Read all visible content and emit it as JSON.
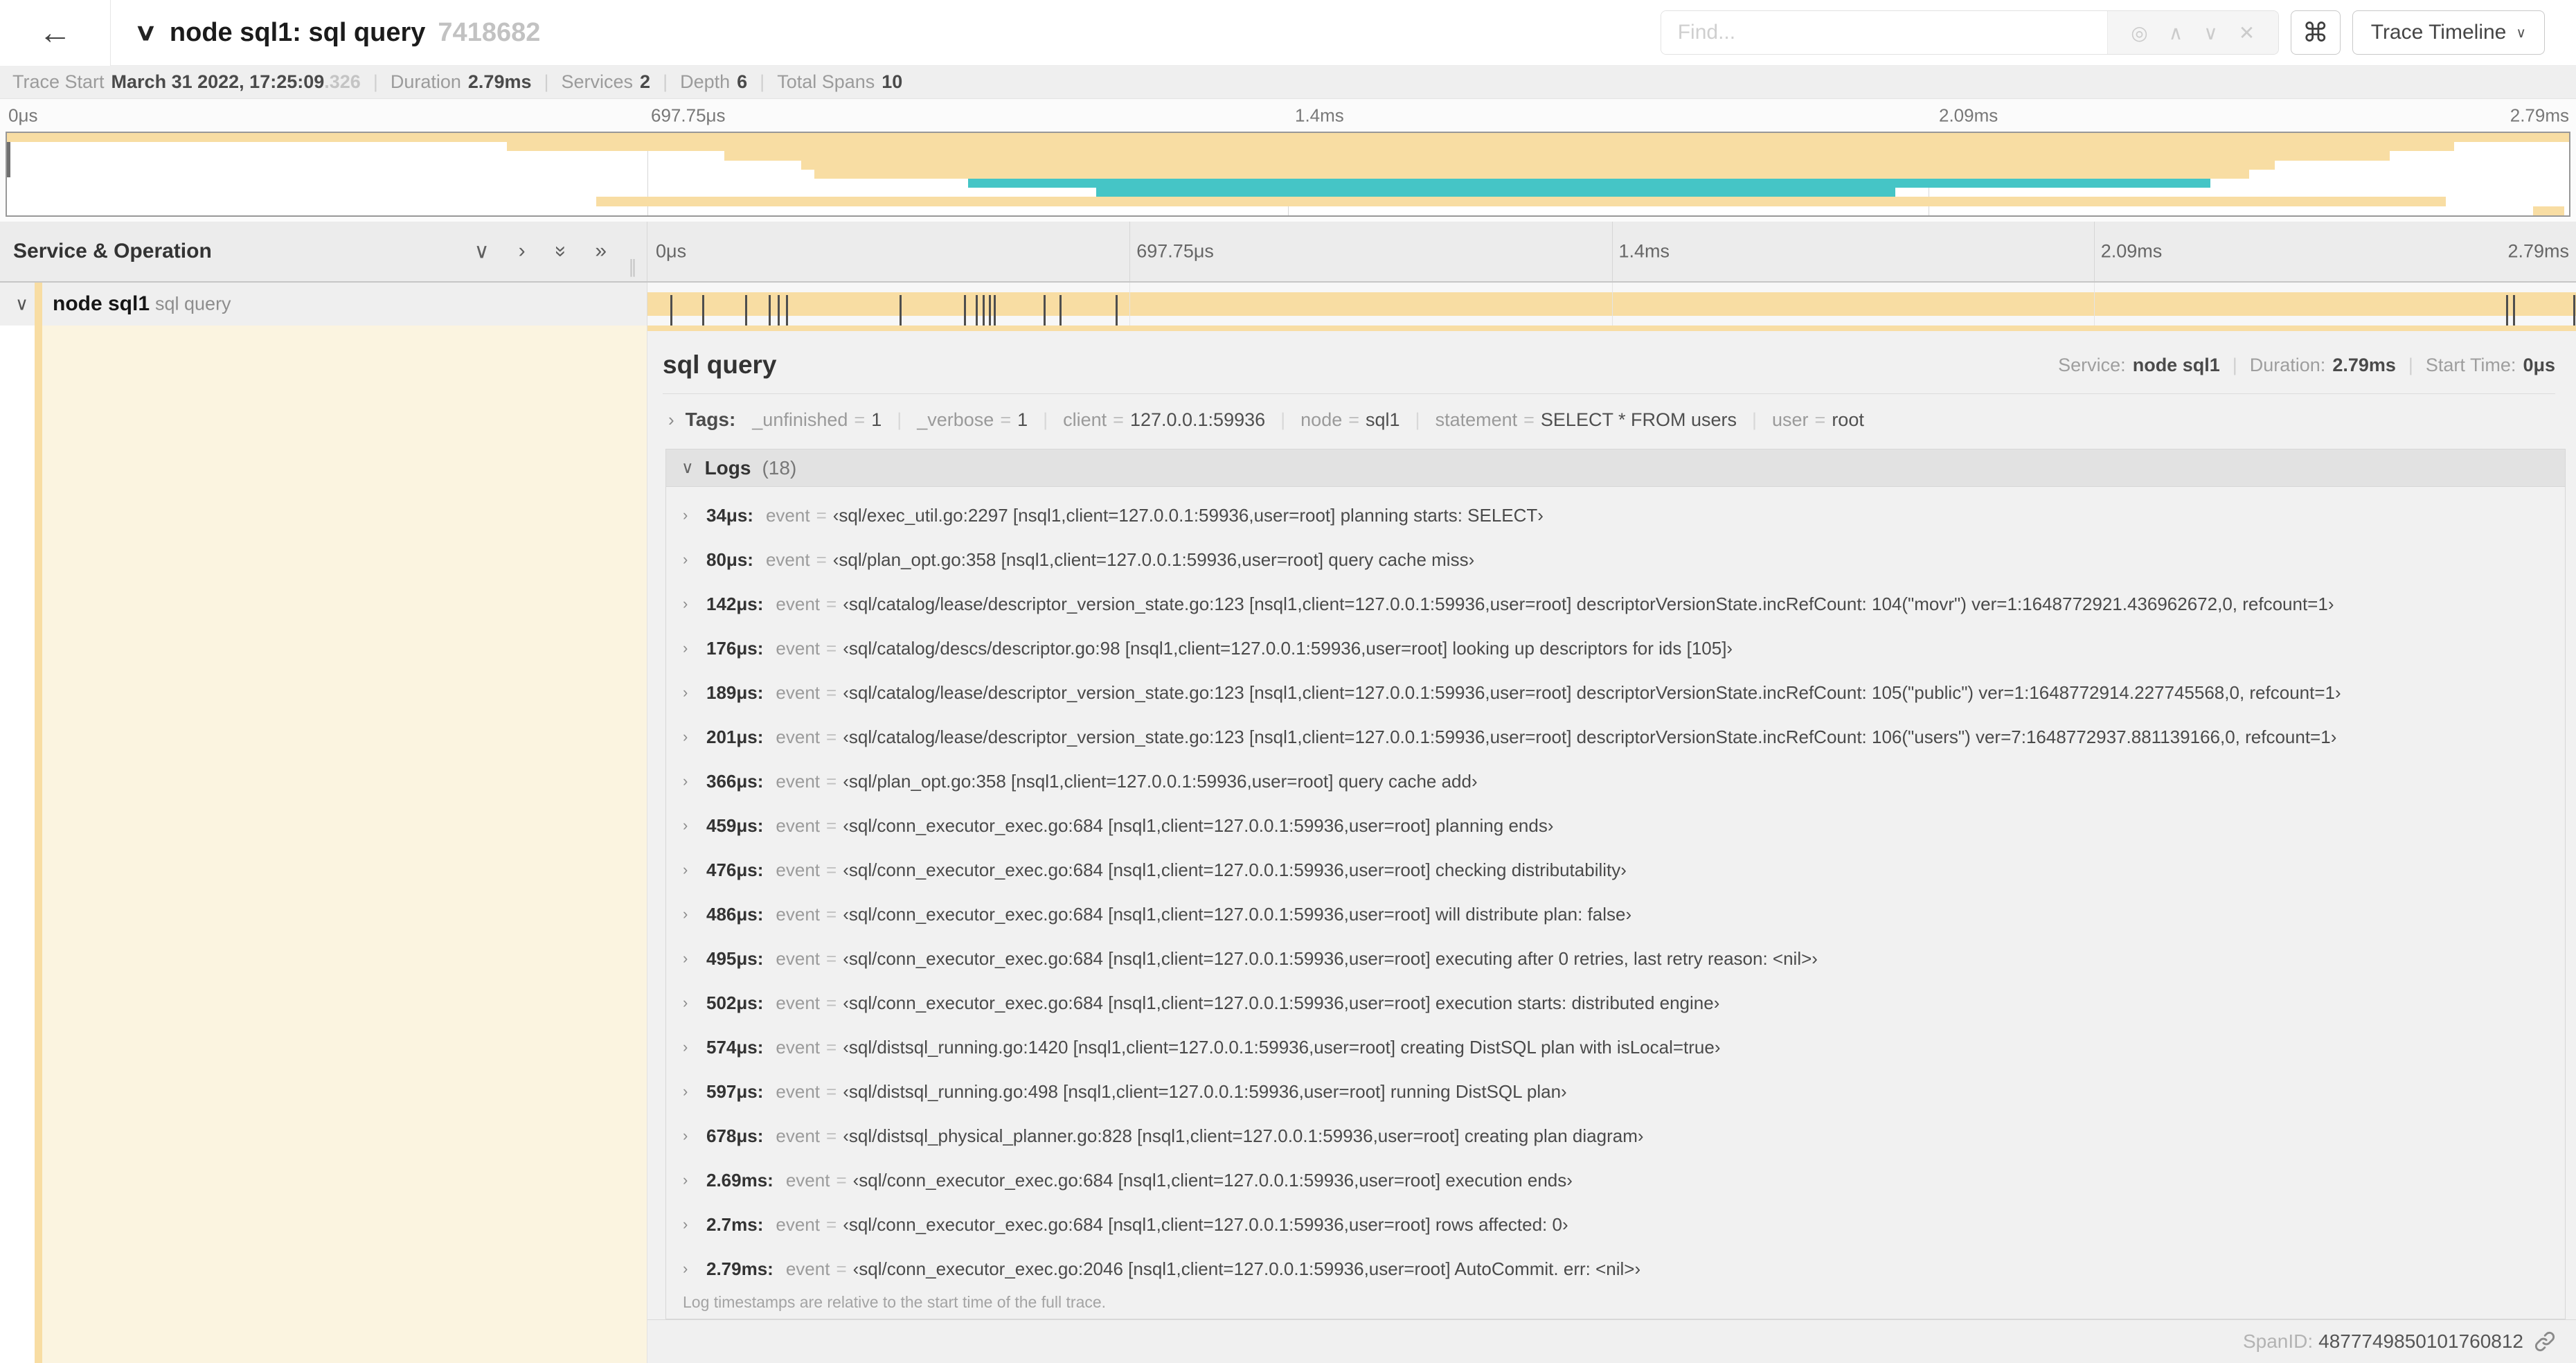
{
  "colors": {
    "tan": "#f8dda3",
    "teal": "#45c5c6"
  },
  "glyphs": {
    "separator": "|",
    "equals": "="
  },
  "icons": {
    "back": "←",
    "collapse": "∨",
    "locate": "◎",
    "prev": "∧",
    "next": "∨",
    "clear": "✕",
    "command": "⌘",
    "caret_down": "∨",
    "collapse_one": "∨",
    "expand_one": "›",
    "collapse_all": "»",
    "expand_all": "»",
    "grip": "∥",
    "row_chevron": "∨",
    "chevron_right": "›",
    "logs_open": "∨"
  },
  "header": {
    "title": "node sql1: sql query",
    "trace_id_short": "7418682",
    "find_placeholder": "Find...",
    "view_selector": "Trace Timeline"
  },
  "summary": {
    "items": [
      {
        "label": "Trace Start",
        "value": "March 31 2022, 17:25:09",
        "suffix": ".326"
      },
      {
        "label": "Duration",
        "value": "2.79ms"
      },
      {
        "label": "Services",
        "value": "2"
      },
      {
        "label": "Depth",
        "value": "6"
      },
      {
        "label": "Total Spans",
        "value": "10"
      }
    ]
  },
  "ruler": {
    "labels": [
      {
        "text": "0μs",
        "pct": 0
      },
      {
        "text": "697.75μs",
        "pct": 25
      },
      {
        "text": "1.4ms",
        "pct": 50
      },
      {
        "text": "2.09ms",
        "pct": 75
      },
      {
        "text": "2.79ms",
        "pct": 100
      }
    ]
  },
  "minimap": {
    "spans": [
      {
        "start": 0,
        "end": 100,
        "color": "tan"
      },
      {
        "start": 19.5,
        "end": 95.5,
        "color": "tan"
      },
      {
        "start": 28,
        "end": 93,
        "color": "tan"
      },
      {
        "start": 31,
        "end": 88.5,
        "color": "tan"
      },
      {
        "start": 31.5,
        "end": 87.5,
        "color": "tan"
      },
      {
        "start": 37.5,
        "end": 86,
        "color": "teal"
      },
      {
        "start": 42.5,
        "end": 73.7,
        "color": "teal"
      },
      {
        "start": 23,
        "end": 95.2,
        "color": "tan"
      },
      {
        "start": 98.6,
        "end": 99.8,
        "color": "tan"
      }
    ]
  },
  "timeline": {
    "left_header": "Service & Operation",
    "row": {
      "service": "node sql1",
      "operation": "sql query",
      "bar_color": "tan"
    },
    "ticks_pct": [
      1.22,
      2.87,
      5.09,
      6.31,
      6.77,
      7.2,
      13.12,
      16.45,
      17.06,
      17.42,
      17.74,
      17.99,
      20.57,
      21.4,
      24.3,
      96.42,
      96.77,
      99.9
    ]
  },
  "detail": {
    "title": "sql query",
    "meta": [
      {
        "label": "Service:",
        "value": "node sql1"
      },
      {
        "label": "Duration:",
        "value": "2.79ms"
      },
      {
        "label": "Start Time:",
        "value": "0μs"
      }
    ],
    "tags_label": "Tags:",
    "tags": [
      {
        "key": "_unfinished",
        "value": "1"
      },
      {
        "key": "_verbose",
        "value": "1"
      },
      {
        "key": "client",
        "value": "127.0.0.1:59936"
      },
      {
        "key": "node",
        "value": "sql1"
      },
      {
        "key": "statement",
        "value": "SELECT * FROM users"
      },
      {
        "key": "user",
        "value": "root"
      }
    ],
    "logs_label": "Logs",
    "logs_count": "(18)",
    "logs": [
      {
        "time": "34μs:",
        "field": "event",
        "text": "‹sql/exec_util.go:2297 [nsql1,client=127.0.0.1:59936,user=root] planning starts: SELECT›"
      },
      {
        "time": "80μs:",
        "field": "event",
        "text": "‹sql/plan_opt.go:358 [nsql1,client=127.0.0.1:59936,user=root] query cache miss›"
      },
      {
        "time": "142μs:",
        "field": "event",
        "text": "‹sql/catalog/lease/descriptor_version_state.go:123 [nsql1,client=127.0.0.1:59936,user=root] descriptorVersionState.incRefCount: 104(\"movr\") ver=1:1648772921.436962672,0, refcount=1›"
      },
      {
        "time": "176μs:",
        "field": "event",
        "text": "‹sql/catalog/descs/descriptor.go:98 [nsql1,client=127.0.0.1:59936,user=root] looking up descriptors for ids [105]›"
      },
      {
        "time": "189μs:",
        "field": "event",
        "text": "‹sql/catalog/lease/descriptor_version_state.go:123 [nsql1,client=127.0.0.1:59936,user=root] descriptorVersionState.incRefCount: 105(\"public\") ver=1:1648772914.227745568,0, refcount=1›"
      },
      {
        "time": "201μs:",
        "field": "event",
        "text": "‹sql/catalog/lease/descriptor_version_state.go:123 [nsql1,client=127.0.0.1:59936,user=root] descriptorVersionState.incRefCount: 106(\"users\") ver=7:1648772937.881139166,0, refcount=1›"
      },
      {
        "time": "366μs:",
        "field": "event",
        "text": "‹sql/plan_opt.go:358 [nsql1,client=127.0.0.1:59936,user=root] query cache add›"
      },
      {
        "time": "459μs:",
        "field": "event",
        "text": "‹sql/conn_executor_exec.go:684 [nsql1,client=127.0.0.1:59936,user=root] planning ends›"
      },
      {
        "time": "476μs:",
        "field": "event",
        "text": "‹sql/conn_executor_exec.go:684 [nsql1,client=127.0.0.1:59936,user=root] checking distributability›"
      },
      {
        "time": "486μs:",
        "field": "event",
        "text": "‹sql/conn_executor_exec.go:684 [nsql1,client=127.0.0.1:59936,user=root] will distribute plan: false›"
      },
      {
        "time": "495μs:",
        "field": "event",
        "text": "‹sql/conn_executor_exec.go:684 [nsql1,client=127.0.0.1:59936,user=root] executing after 0 retries, last retry reason: <nil>›"
      },
      {
        "time": "502μs:",
        "field": "event",
        "text": "‹sql/conn_executor_exec.go:684 [nsql1,client=127.0.0.1:59936,user=root] execution starts: distributed engine›"
      },
      {
        "time": "574μs:",
        "field": "event",
        "text": "‹sql/distsql_running.go:1420 [nsql1,client=127.0.0.1:59936,user=root] creating DistSQL plan with isLocal=true›"
      },
      {
        "time": "597μs:",
        "field": "event",
        "text": "‹sql/distsql_running.go:498 [nsql1,client=127.0.0.1:59936,user=root] running DistSQL plan›"
      },
      {
        "time": "678μs:",
        "field": "event",
        "text": "‹sql/distsql_physical_planner.go:828 [nsql1,client=127.0.0.1:59936,user=root] creating plan diagram›"
      },
      {
        "time": "2.69ms:",
        "field": "event",
        "text": "‹sql/conn_executor_exec.go:684 [nsql1,client=127.0.0.1:59936,user=root] execution ends›"
      },
      {
        "time": "2.7ms:",
        "field": "event",
        "text": "‹sql/conn_executor_exec.go:684 [nsql1,client=127.0.0.1:59936,user=root] rows affected: 0›"
      },
      {
        "time": "2.79ms:",
        "field": "event",
        "text": "‹sql/conn_executor_exec.go:2046 [nsql1,client=127.0.0.1:59936,user=root] AutoCommit. err: <nil>›"
      }
    ],
    "logs_note": "Log timestamps are relative to the start time of the full trace.",
    "footer": {
      "label": "SpanID:",
      "value": "4877749850101760812"
    }
  }
}
